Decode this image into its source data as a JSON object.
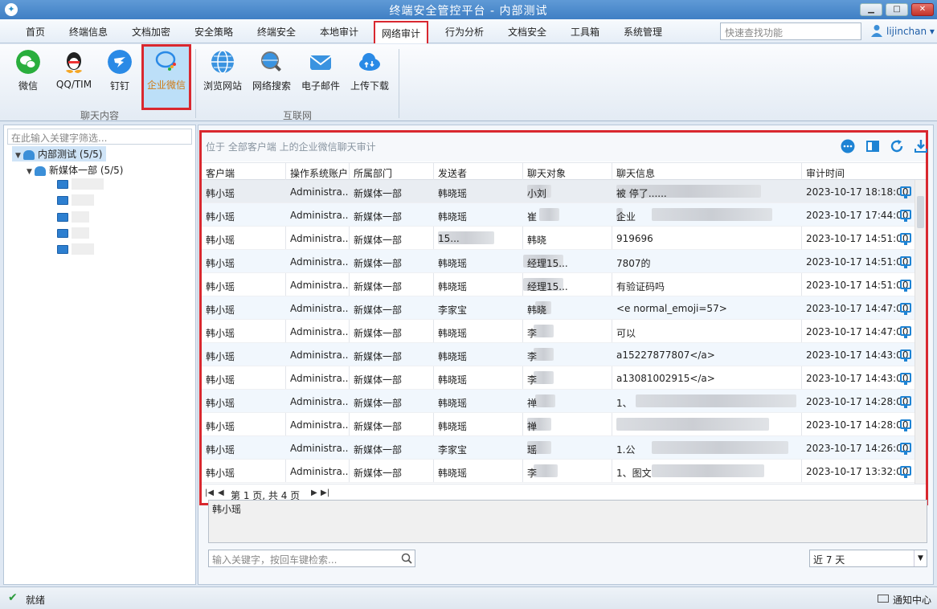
{
  "window": {
    "title": "终端安全管控平台 - 内部测试",
    "min": "▁",
    "max": "□",
    "close": "✕"
  },
  "menu": {
    "tabs": [
      "首页",
      "终端信息",
      "文档加密",
      "安全策略",
      "终端安全",
      "本地审计",
      "网络审计",
      "行为分析",
      "文档安全",
      "工具箱",
      "系统管理"
    ],
    "active": "网络审计",
    "quick_search_placeholder": "快速查找功能",
    "user": "lijinchan ▾"
  },
  "ribbon": {
    "chat_group_label": "聊天内容",
    "internet_group_label": "互联网",
    "chat_buttons": [
      "微信",
      "QQ/TIM",
      "钉钉",
      "企业微信"
    ],
    "internet_buttons": [
      "浏览网站",
      "网络搜索",
      "电子邮件",
      "上传下载"
    ],
    "active": "企业微信"
  },
  "tree": {
    "filter_placeholder": "在此输入关键字筛选...",
    "root": "内部测试 (5/5)",
    "dept": "新媒体一部 (5/5)"
  },
  "grid": {
    "location": "位于 全部客户端 上的企业微信聊天审计",
    "columns": [
      "客户端",
      "操作系统账户",
      "所属部门",
      "发送者",
      "聊天对象",
      "聊天信息",
      "审计时间"
    ],
    "rows": [
      {
        "client": "韩小瑶",
        "account": "Administra...",
        "dept": "新媒体一部",
        "sender": "韩晓瑶",
        "target": "小刘",
        "message": "被 停了......",
        "time": "2023-10-17 18:18:00"
      },
      {
        "client": "韩小瑶",
        "account": "Administra...",
        "dept": "新媒体一部",
        "sender": "韩晓瑶",
        "target": "崔",
        "message": "企业",
        "time": "2023-10-17 17:44:00"
      },
      {
        "client": "韩小瑶",
        "account": "Administra...",
        "dept": "新媒体一部",
        "sender": "15...",
        "target": "韩晓",
        "message": "919696",
        "time": "2023-10-17 14:51:00"
      },
      {
        "client": "韩小瑶",
        "account": "Administra...",
        "dept": "新媒体一部",
        "sender": "韩晓瑶",
        "target": "经理15...",
        "message": "7807的",
        "time": "2023-10-17 14:51:00"
      },
      {
        "client": "韩小瑶",
        "account": "Administra...",
        "dept": "新媒体一部",
        "sender": "韩晓瑶",
        "target": "经理15...",
        "message": "有验证码吗",
        "time": "2023-10-17 14:51:00"
      },
      {
        "client": "韩小瑶",
        "account": "Administra...",
        "dept": "新媒体一部",
        "sender": "李家宝",
        "target": "韩晓",
        "message": "<e normal_emoji=57>",
        "time": "2023-10-17 14:47:00"
      },
      {
        "client": "韩小瑶",
        "account": "Administra...",
        "dept": "新媒体一部",
        "sender": "韩晓瑶",
        "target": "李",
        "message": "可以",
        "time": "2023-10-17 14:47:00"
      },
      {
        "client": "韩小瑶",
        "account": "Administra...",
        "dept": "新媒体一部",
        "sender": "韩晓瑶",
        "target": "李",
        "message": "a15227877807</a>",
        "time": "2023-10-17 14:43:00"
      },
      {
        "client": "韩小瑶",
        "account": "Administra...",
        "dept": "新媒体一部",
        "sender": "韩晓瑶",
        "target": "李",
        "message": "a13081002915</a>",
        "time": "2023-10-17 14:43:00"
      },
      {
        "client": "韩小瑶",
        "account": "Administra...",
        "dept": "新媒体一部",
        "sender": "韩晓瑶",
        "target": "禅",
        "message": "1、",
        "time": "2023-10-17 14:28:00"
      },
      {
        "client": "韩小瑶",
        "account": "Administra...",
        "dept": "新媒体一部",
        "sender": "韩晓瑶",
        "target": "禅",
        "message": "",
        "time": "2023-10-17 14:28:00"
      },
      {
        "client": "韩小瑶",
        "account": "Administra...",
        "dept": "新媒体一部",
        "sender": "李家宝",
        "target": "瑶",
        "message": "1.公",
        "time": "2023-10-17 14:26:00"
      },
      {
        "client": "韩小瑶",
        "account": "Administra...",
        "dept": "新媒体一部",
        "sender": "韩晓瑶",
        "target": "李",
        "message": "1、图文",
        "time": "2023-10-17 13:32:00"
      }
    ],
    "pager": "第 1 页, 共 4 页"
  },
  "detail_text": "韩小瑶",
  "keyword_placeholder": "输入关键字，按回车键检索...",
  "range": "近 7 天",
  "status": {
    "check": "✔",
    "text": "就绪",
    "notice": "通知中心"
  }
}
